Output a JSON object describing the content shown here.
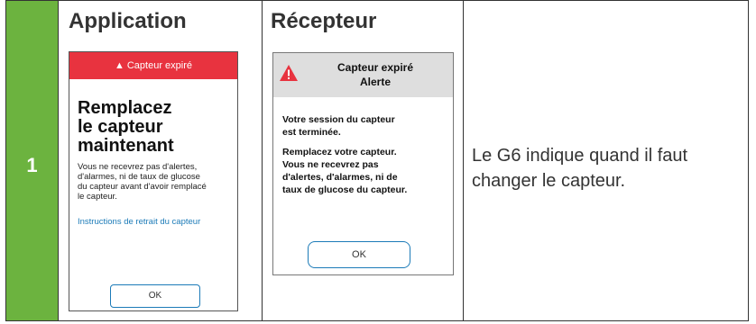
{
  "step_number": "1",
  "columns": {
    "app": "Application",
    "receiver": "Récepteur"
  },
  "app_screen": {
    "banner": "Capteur expiré",
    "title_lines": [
      "Remplacez",
      "le capteur",
      "maintenant"
    ],
    "body_lines": [
      "Vous ne recevrez pas d'alertes,",
      "d'alarmes, ni de taux de glucose",
      "du capteur avant d'avoir remplacé",
      "le capteur."
    ],
    "link": "Instructions de retrait du capteur",
    "ok_button": "OK"
  },
  "receiver_screen": {
    "header_lines": [
      "Capteur expiré",
      "Alerte"
    ],
    "body_lines": [
      "Votre session du capteur",
      "est terminée.",
      "",
      "Remplacez votre capteur.",
      "Vous ne recevrez pas",
      "d'alertes, d'alarmes, ni de",
      "taux de glucose du capteur."
    ],
    "ok_button": "OK"
  },
  "description_lines": [
    "Le G6 indique quand il faut",
    "changer le capteur."
  ],
  "colors": {
    "step_green": "#6cb33f",
    "alert_red": "#e8333f",
    "link_blue": "#1c7bb8",
    "receiver_header_gray": "#dedede"
  },
  "icons": {
    "warning": "warning-triangle-icon"
  }
}
